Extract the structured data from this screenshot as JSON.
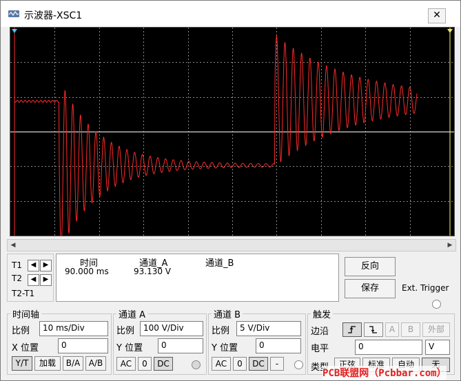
{
  "window": {
    "title": "示波器-XSC1",
    "close_glyph": "✕"
  },
  "readout": {
    "cursor1": "T1",
    "cursor2": "T2",
    "diff": "T2-T1",
    "headers": {
      "time": "时间",
      "channel_a": "通道_A",
      "channel_b": "通道_B"
    },
    "t1_time": "90.000 ms",
    "t1_channel_a": "93.130 V"
  },
  "buttons": {
    "reverse": "反向",
    "save": "保存",
    "ext_trigger": "Ext. Trigger"
  },
  "timebase": {
    "title": "时间轴",
    "scale_label": "比例",
    "scale_value": "10 ms/Div",
    "xpos_label": "X 位置",
    "xpos_value": "0",
    "modes": [
      "Y/T",
      "加载",
      "B/A",
      "A/B"
    ]
  },
  "channel_a": {
    "title": "通道 A",
    "scale_label": "比例",
    "scale_value": "100  V/Div",
    "ypos_label": "Y 位置",
    "ypos_value": "0",
    "coupling": [
      "AC",
      "0",
      "DC"
    ]
  },
  "channel_b": {
    "title": "通道 B",
    "scale_label": "比例",
    "scale_value": "5  V/Div",
    "ypos_label": "Y 位置",
    "ypos_value": "0",
    "coupling": [
      "AC",
      "0",
      "DC",
      "-"
    ]
  },
  "trigger": {
    "title": "触发",
    "edge_label": "边沿",
    "edge_buttons": [
      "A",
      "B",
      "外部"
    ],
    "level_label": "电平",
    "level_value": "0",
    "level_unit": "V",
    "type_label": "类型",
    "type_buttons": [
      "正弦",
      "标准",
      "自动",
      "无"
    ]
  },
  "watermark": "PCB联盟网（Pcbbar.com）",
  "colors": {
    "trace": "#ff2a2a",
    "screen": "#000000",
    "grid": "#8a8a8a",
    "axis": "#ffffff"
  },
  "chart_data": {
    "type": "line",
    "series": [
      {
        "description": "channel A damped oscillation",
        "samples": "procedural"
      }
    ],
    "x_divisions": 10,
    "y_divisions": 6
  }
}
